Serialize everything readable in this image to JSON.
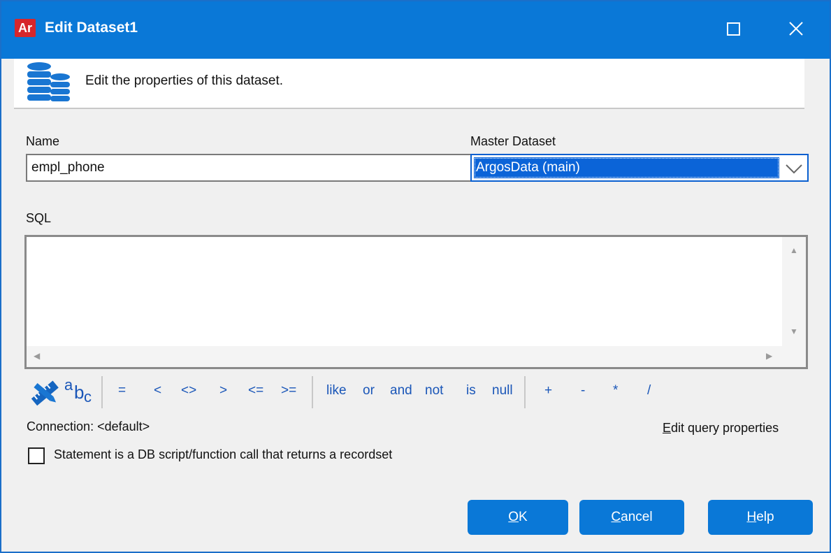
{
  "window": {
    "app_icon_text": "Ar",
    "title": "Edit Dataset1"
  },
  "header": {
    "icon": "database-stack-icon",
    "text": "Edit the properties of this dataset."
  },
  "form": {
    "name_label": "Name",
    "name_value": "empl_phone",
    "master_label": "Master Dataset",
    "master_value": "ArgosData (main)",
    "sql_label": "SQL",
    "sql_value": ""
  },
  "toolbar": {
    "icon_tool": "ruler-pencil-icon",
    "icon_abc_a": "a",
    "icon_abc_b": "b",
    "icon_abc_c": "c",
    "ops1": [
      "=",
      "<",
      "<>",
      ">",
      "<=",
      ">="
    ],
    "ops2": [
      "like",
      "or",
      "and",
      "not",
      "is",
      "null"
    ],
    "ops3": [
      "+",
      "-",
      "*",
      "/"
    ]
  },
  "connection": "Connection: <default>",
  "edit_query_properties": {
    "accel": "E",
    "rest": "dit query properties"
  },
  "checkbox": {
    "label": "Statement is a DB script/function call that returns a recordset",
    "checked": false
  },
  "buttons": {
    "ok": {
      "accel": "O",
      "rest": "K"
    },
    "cancel": {
      "accel": "C",
      "rest": "ancel"
    },
    "help": {
      "accel": "H",
      "rest": "elp"
    }
  },
  "colors": {
    "titlebar": "#0a78d7",
    "accent": "#0b64d8",
    "app_icon": "#d7262b"
  }
}
